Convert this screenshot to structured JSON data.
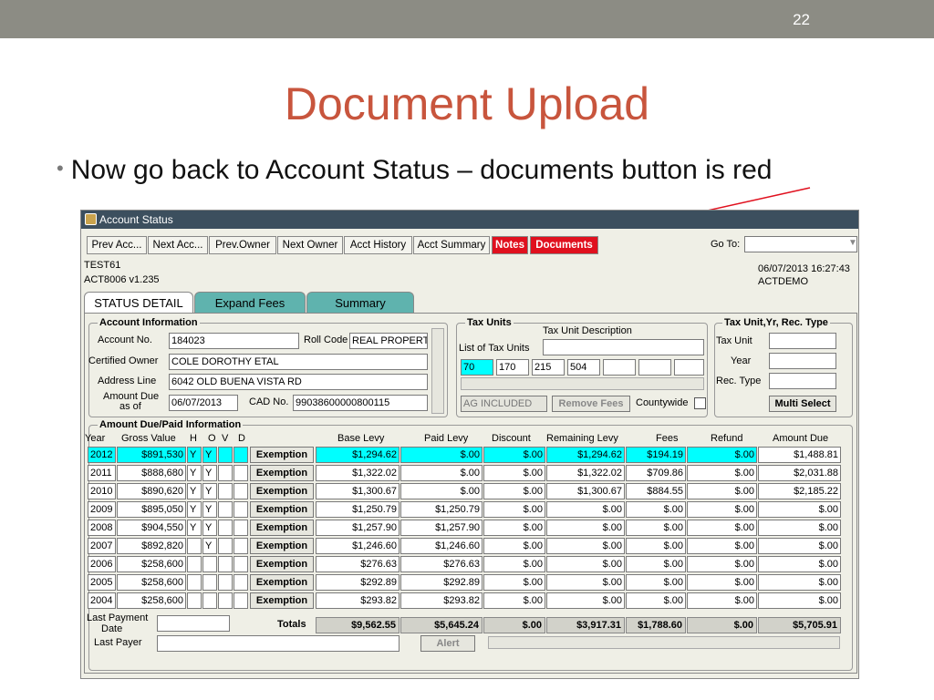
{
  "slide": {
    "page_number": "22",
    "title": "Document Upload",
    "bullet": "Now go back to Account Status – documents button is red"
  },
  "window": {
    "title": "Account Status",
    "toolbar": [
      "Prev Acc...",
      "Next Acc...",
      "Prev.Owner",
      "Next Owner",
      "Acct History",
      "Acct Summary",
      "Notes",
      "Documents"
    ],
    "goto_label": "Go To:",
    "info_left": [
      "TEST61",
      "ACT8006    v1.235"
    ],
    "info_right": [
      "06/07/2013 16:27:43",
      "ACTDEMO"
    ],
    "tabs": [
      "STATUS DETAIL",
      "Expand Fees",
      "Summary"
    ],
    "colors": {
      "red_button": "#e0101e",
      "highlight": "#00ffff",
      "tab_inactive": "#5fb3ae"
    }
  },
  "account": {
    "group_label": "Account Information",
    "account_no_label": "Account No.",
    "account_no": "184023",
    "roll_code_label": "Roll Code",
    "roll_code": "REAL PROPERT",
    "certified_owner_label": "Certified Owner",
    "certified_owner": "COLE DOROTHY ETAL",
    "address_label": "Address Line",
    "address": "6042 OLD BUENA VISTA RD",
    "amount_due_label_1": "Amount Due",
    "amount_due_label_2": "as of",
    "amount_due_date": "06/07/2013",
    "cad_label": "CAD No.",
    "cad_no": "99038600000800115"
  },
  "tax_units": {
    "group_label": "Tax Units",
    "desc_label": "Tax Unit Description",
    "list_label": "List of Tax Units",
    "units": [
      "70",
      "170",
      "215",
      "504",
      "",
      "",
      ""
    ],
    "ag_value": "AG INCLUDED",
    "remove_fees": "Remove Fees",
    "countywide": "Countywide"
  },
  "tax_unit_yr": {
    "group_label": "Tax Unit,Yr, Rec. Type",
    "tax_unit_label": "Tax Unit",
    "year_label": "Year",
    "rec_type_label": "Rec. Type",
    "multi_select": "Multi Select"
  },
  "amounts": {
    "group_label": "Amount Due/Paid Information",
    "headers": [
      "Year",
      "Gross Value",
      "H",
      "O",
      "V",
      "D",
      "Base Levy",
      "Paid Levy",
      "Discount",
      "Remaining Levy",
      "Fees",
      "Refund",
      "Amount Due"
    ],
    "rows": [
      {
        "year": "2012",
        "gross": "$891,530",
        "h": "Y",
        "o": "Y",
        "v": "",
        "d": "",
        "btn": "Exemption",
        "base": "$1,294.62",
        "paid": "$.00",
        "disc": "$.00",
        "rem": "$1,294.62",
        "fees": "$194.19",
        "refund": "$.00",
        "due": "$1,488.81"
      },
      {
        "year": "2011",
        "gross": "$888,680",
        "h": "Y",
        "o": "Y",
        "v": "",
        "d": "",
        "btn": "Exemption",
        "base": "$1,322.02",
        "paid": "$.00",
        "disc": "$.00",
        "rem": "$1,322.02",
        "fees": "$709.86",
        "refund": "$.00",
        "due": "$2,031.88"
      },
      {
        "year": "2010",
        "gross": "$890,620",
        "h": "Y",
        "o": "Y",
        "v": "",
        "d": "",
        "btn": "Exemption",
        "base": "$1,300.67",
        "paid": "$.00",
        "disc": "$.00",
        "rem": "$1,300.67",
        "fees": "$884.55",
        "refund": "$.00",
        "due": "$2,185.22"
      },
      {
        "year": "2009",
        "gross": "$895,050",
        "h": "Y",
        "o": "Y",
        "v": "",
        "d": "",
        "btn": "Exemption",
        "base": "$1,250.79",
        "paid": "$1,250.79",
        "disc": "$.00",
        "rem": "$.00",
        "fees": "$.00",
        "refund": "$.00",
        "due": "$.00"
      },
      {
        "year": "2008",
        "gross": "$904,550",
        "h": "Y",
        "o": "Y",
        "v": "",
        "d": "",
        "btn": "Exemption",
        "base": "$1,257.90",
        "paid": "$1,257.90",
        "disc": "$.00",
        "rem": "$.00",
        "fees": "$.00",
        "refund": "$.00",
        "due": "$.00"
      },
      {
        "year": "2007",
        "gross": "$892,820",
        "h": "",
        "o": "Y",
        "v": "",
        "d": "",
        "btn": "Exemption",
        "base": "$1,246.60",
        "paid": "$1,246.60",
        "disc": "$.00",
        "rem": "$.00",
        "fees": "$.00",
        "refund": "$.00",
        "due": "$.00"
      },
      {
        "year": "2006",
        "gross": "$258,600",
        "h": "",
        "o": "",
        "v": "",
        "d": "",
        "btn": "Exemption",
        "base": "$276.63",
        "paid": "$276.63",
        "disc": "$.00",
        "rem": "$.00",
        "fees": "$.00",
        "refund": "$.00",
        "due": "$.00"
      },
      {
        "year": "2005",
        "gross": "$258,600",
        "h": "",
        "o": "",
        "v": "",
        "d": "",
        "btn": "Exemption",
        "base": "$292.89",
        "paid": "$292.89",
        "disc": "$.00",
        "rem": "$.00",
        "fees": "$.00",
        "refund": "$.00",
        "due": "$.00"
      },
      {
        "year": "2004",
        "gross": "$258,600",
        "h": "",
        "o": "",
        "v": "",
        "d": "",
        "btn": "Exemption",
        "base": "$293.82",
        "paid": "$293.82",
        "disc": "$.00",
        "rem": "$.00",
        "fees": "$.00",
        "refund": "$.00",
        "due": "$.00"
      }
    ],
    "last_payment_label_1": "Last Payment",
    "last_payment_label_2": "Date",
    "totals_label": "Totals",
    "totals": {
      "base": "$9,562.55",
      "paid": "$5,645.24",
      "disc": "$.00",
      "rem": "$3,917.31",
      "fees": "$1,788.60",
      "refund": "$.00",
      "due": "$5,705.91"
    },
    "last_payer_label": "Last Payer",
    "alert": "Alert"
  }
}
